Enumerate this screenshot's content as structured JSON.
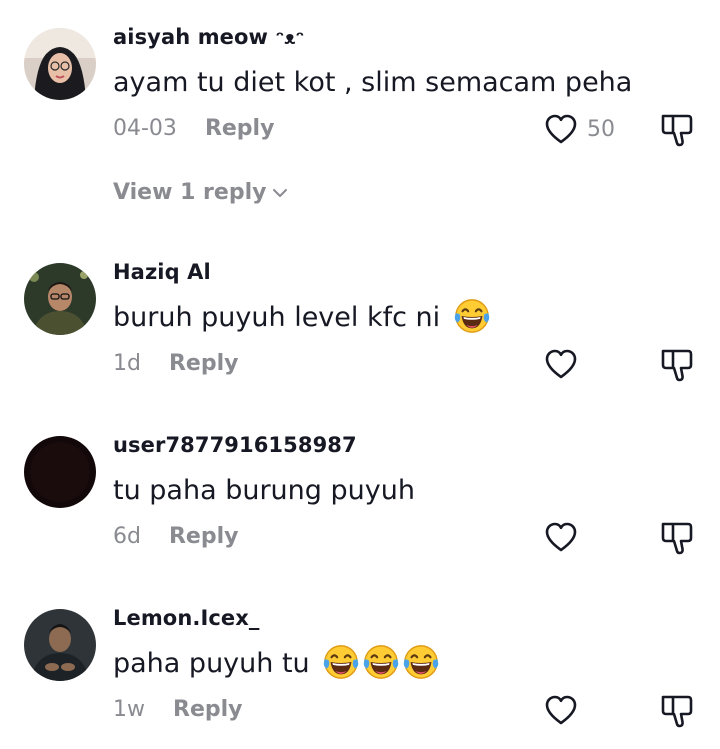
{
  "comments": [
    {
      "username": "aisyah meow",
      "username_suffix": "ᵔᴥᵔ",
      "text": "ayam tu diet kot , slim semacam peha",
      "time": "04-03",
      "reply_label": "Reply",
      "likes": "50",
      "view_replies": "View 1 reply",
      "avatar": "woman-in-hijab-avatar"
    },
    {
      "username": "Haziq Al",
      "text": "buruh puyuh level kfc ni",
      "emojis": [
        "tears-of-joy"
      ],
      "time": "1d",
      "reply_label": "Reply",
      "avatar": "man-with-glasses-avatar"
    },
    {
      "username": "user7877916158987",
      "text": "tu paha burung puyuh",
      "time": "6d",
      "reply_label": "Reply",
      "avatar": "dark-blank-avatar"
    },
    {
      "username": "Lemon.Icex_",
      "text": "paha puyuh tu",
      "emojis": [
        "tears-of-joy",
        "tears-of-joy",
        "tears-of-joy"
      ],
      "time": "1w",
      "reply_label": "Reply",
      "avatar": "person-portrait-avatar"
    }
  ],
  "colors": {
    "primary_text": "#161823",
    "secondary_text": "#8a8b91",
    "emoji_face": "#ffcc33",
    "emoji_tears": "#4aa3e8"
  },
  "icons": [
    "heart-outline-icon",
    "thumb-down-outline-icon",
    "chevron-down-icon",
    "tears-of-joy-emoji"
  ]
}
